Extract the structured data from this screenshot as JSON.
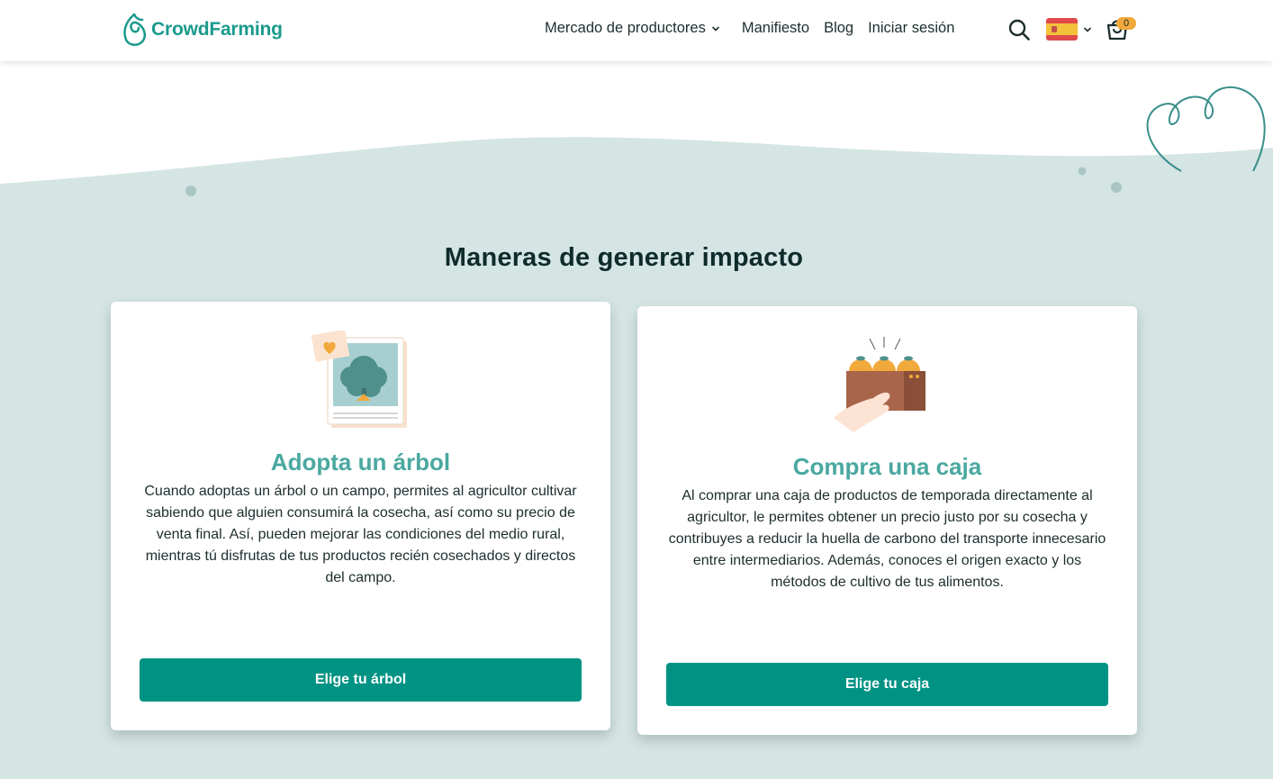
{
  "brand": {
    "name": "CrowdFarming",
    "color": "#1a9a8c"
  },
  "nav": {
    "items": [
      {
        "label": "Mercado de productores",
        "has_dropdown": true
      },
      {
        "label": "Manifiesto"
      },
      {
        "label": "Blog"
      },
      {
        "label": "Iniciar sesión"
      }
    ],
    "cart_count": "0",
    "language": "ES"
  },
  "section": {
    "heading": "Maneras de generar impacto"
  },
  "cards": [
    {
      "title": "Adopta un árbol",
      "text": "Cuando adoptas un árbol o un campo, permites al agricultor cultivar sabiendo que alguien consumirá la cosecha, así como su precio de venta final. Así, pueden mejorar las condiciones del medio rural, mientras tú disfrutas de tus productos recién cosechados y directos del campo.",
      "button": "Elige tu árbol",
      "icon": "tree-photo-icon"
    },
    {
      "title": "Compra una caja",
      "text": "Al comprar una caja de productos de temporada directamente al agricultor, le permites obtener un precio justo por su cosecha y contribuyes a reducir la huella de carbono del transporte innecesario entre intermediarios. Además, conoces el origen exacto y los métodos de cultivo de tus alimentos.",
      "button": "Elige tu caja",
      "icon": "orange-box-icon"
    }
  ],
  "colors": {
    "accent": "#009384",
    "title": "#4aa8a0",
    "background": "#d4e5e4",
    "badge": "#f2a93b"
  }
}
